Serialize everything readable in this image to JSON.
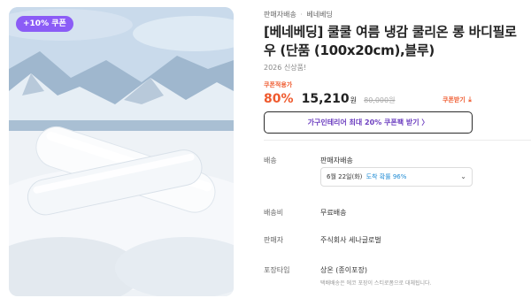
{
  "gallery": {
    "badge": "+10% 쿠폰"
  },
  "breadcrumb": {
    "items": [
      "판매자배송",
      "베네베딩"
    ],
    "separator": "·"
  },
  "product": {
    "title": "[베네베딩] 쿨쿨 여름 냉감 쿨리온 롱 바디필로우 (단품 (100x20cm),블루)",
    "subtitle": "2026 신상품!"
  },
  "pricing": {
    "coupon_label": "쿠폰적용가",
    "discount": "80%",
    "price": "15,210",
    "currency": "원",
    "original_price": "80,000원",
    "coupon_download_label": "쿠폰받기",
    "coupon_download_icon": "download-icon"
  },
  "cta": {
    "label": "가구인테리어 최대 20% 쿠폰팩 받기 〉"
  },
  "details": {
    "shipping_label": "배송",
    "shipping_value": "판매자배송",
    "delivery_date": "6월 22일(화)",
    "delivery_eta": "도착 확률 96%",
    "shipping_fee_label": "배송비",
    "shipping_fee_value": "무료배송",
    "seller_label": "판매자",
    "seller_value": "주식회사 세나글로벌",
    "packaging_label": "포장타입",
    "packaging_value": "상온 (종이포장)",
    "packaging_note": "택배배송은 에코 포장이 스티로폼으로 대체됩니다."
  },
  "colors": {
    "accent_orange": "#ef5a2e",
    "accent_purple": "#8b5cf6",
    "eta_blue": "#1e8bd4"
  }
}
